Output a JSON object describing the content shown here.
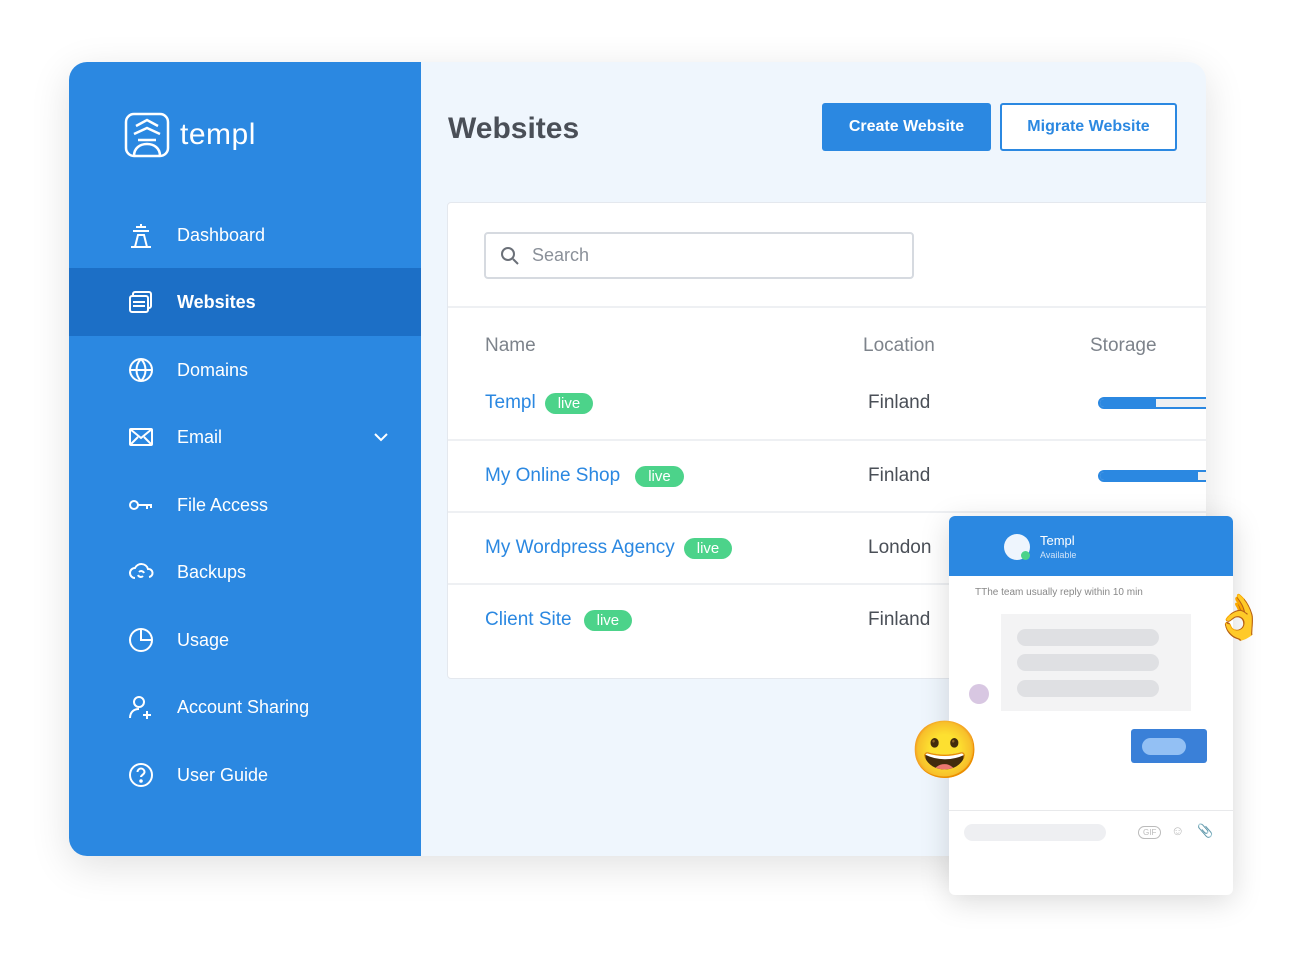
{
  "brand": {
    "name": "templ"
  },
  "sidebar": {
    "items": [
      {
        "label": "Dashboard",
        "icon": "dashboard-icon"
      },
      {
        "label": "Websites",
        "icon": "websites-icon",
        "active": true
      },
      {
        "label": "Domains",
        "icon": "globe-icon"
      },
      {
        "label": "Email",
        "icon": "mail-icon",
        "expandable": true
      },
      {
        "label": "File Access",
        "icon": "key-icon"
      },
      {
        "label": "Backups",
        "icon": "cloud-sync-icon"
      },
      {
        "label": "Usage",
        "icon": "pie-chart-icon"
      },
      {
        "label": "Account Sharing",
        "icon": "user-add-icon"
      },
      {
        "label": "User Guide",
        "icon": "help-icon"
      }
    ]
  },
  "header": {
    "title": "Websites",
    "create_label": "Create Website",
    "migrate_label": "Migrate Website"
  },
  "search": {
    "placeholder": "Search"
  },
  "table": {
    "columns": [
      "Name",
      "Location",
      "Storage"
    ],
    "rows": [
      {
        "name": "Templ",
        "status": "live",
        "location": "Finland",
        "storage": 0.36
      },
      {
        "name": "My Online Shop",
        "status": "live",
        "location": "Finland",
        "storage": 0.63
      },
      {
        "name": "My Wordpress Agency",
        "status": "live",
        "location": "London"
      },
      {
        "name": "Client Site",
        "status": "live",
        "location": "Finland"
      }
    ]
  },
  "chat": {
    "name": "Templ",
    "status": "Available",
    "note": "TThe team usually reply within 10 min",
    "gif_label": "GIF"
  },
  "colors": {
    "primary": "#2b88e1",
    "active": "#1c6fc6",
    "live": "#4cd38a"
  }
}
